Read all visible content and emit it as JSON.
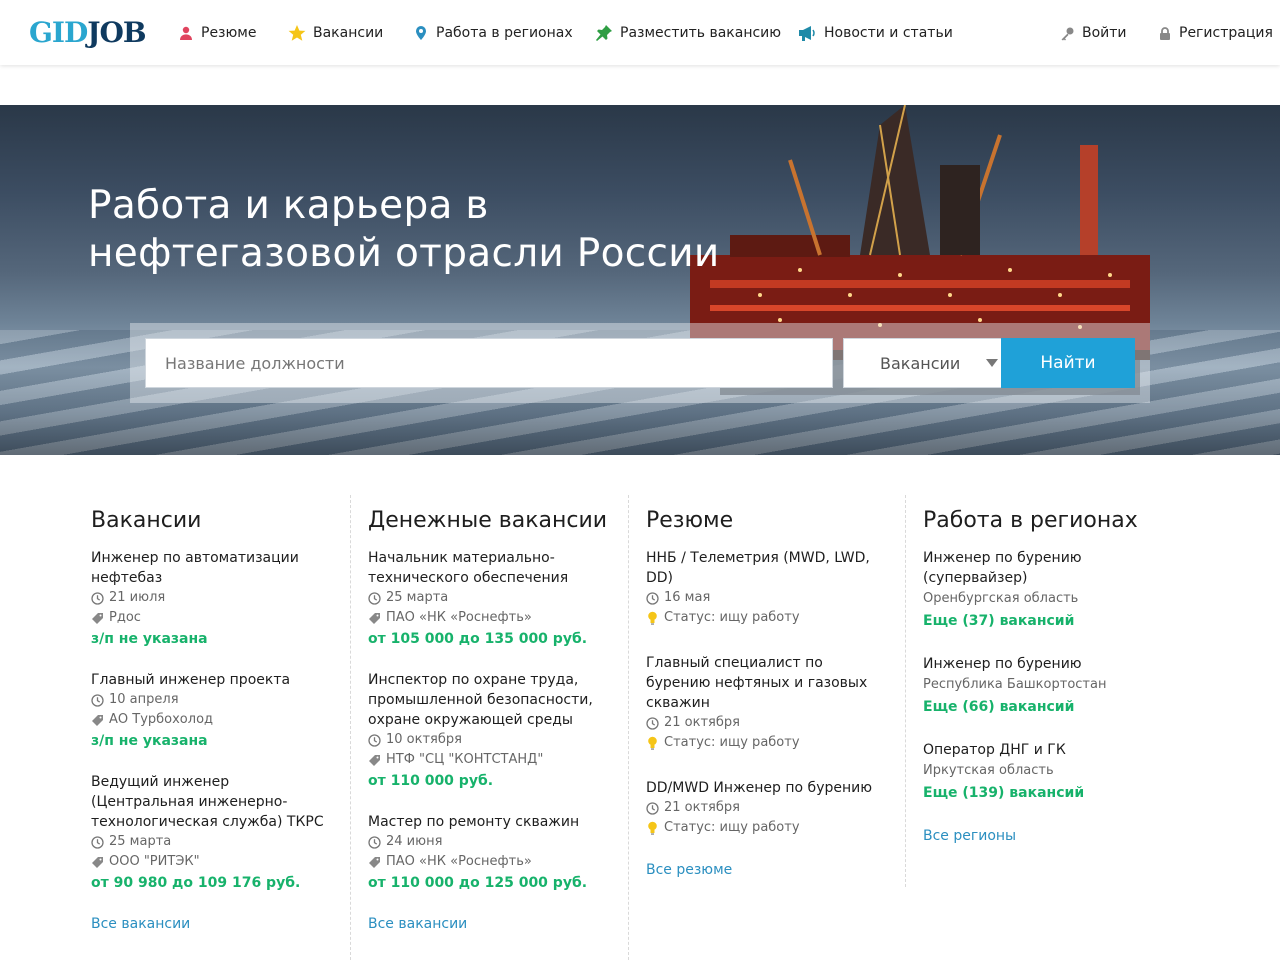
{
  "header": {
    "logo_part1": "GID",
    "logo_part2": "JOB",
    "nav": [
      {
        "label": "Резюме",
        "icon": "user-icon"
      },
      {
        "label": "Вакансии",
        "icon": "star-icon"
      },
      {
        "label": "Работа в регионах",
        "icon": "map-pin-icon"
      },
      {
        "label": "Разместить вакансию",
        "icon": "pushpin-icon"
      },
      {
        "label": "Новости и статьи",
        "icon": "megaphone-icon"
      }
    ],
    "login": "Войти",
    "register": "Регистрация"
  },
  "hero": {
    "title_line1": "Работа и карьера в",
    "title_line2": "нефтегазовой отрасли России",
    "search_placeholder": "Название должности",
    "select_value": "Вакансии",
    "search_button": "Найти"
  },
  "columns": {
    "vacancies": {
      "heading": "Вакансии",
      "items": [
        {
          "title": "Инженер по автоматизации нефтебаз",
          "date": "21 июля",
          "company": "Рдос",
          "salary": "з/п не указана"
        },
        {
          "title": "Главный инженер проекта",
          "date": "10 апреля",
          "company": "АО Турбохолод",
          "salary": "з/п не указана"
        },
        {
          "title": "Ведущий инженер (Центральная инженерно-технологическая служба) ТКРС",
          "date": "25 марта",
          "company": "ООО \"РИТЭК\"",
          "salary": "от 90 980 до 109 176 руб."
        }
      ],
      "all_link": "Все вакансии"
    },
    "money": {
      "heading": "Денежные вакансии",
      "items": [
        {
          "title": "Начальник материально-технического обеспечения",
          "date": "25 марта",
          "company": "ПАО «НК «Роснефть»",
          "salary": "от 105 000 до 135 000 руб."
        },
        {
          "title": "Инспектор по охране труда, промышленной безопасности, охране окружающей среды",
          "date": "10 октября",
          "company": "НТФ \"СЦ \"КОНТСТАНД\"",
          "salary": "от 110 000 руб."
        },
        {
          "title": "Мастер по ремонту скважин",
          "date": "24 июня",
          "company": "ПАО «НК «Роснефть»",
          "salary": "от 110 000 до 125 000 руб."
        }
      ],
      "all_link": "Все вакансии"
    },
    "resume": {
      "heading": "Резюме",
      "items": [
        {
          "title": "ННБ / Телеметрия (MWD, LWD, DD)",
          "date": "16 мая",
          "status": "Статус: ищу работу"
        },
        {
          "title": "Главный специалист по бурению нефтяных и газовых скважин",
          "date": "21 октября",
          "status": "Статус: ищу работу"
        },
        {
          "title": "DD/MWD Инженер по бурению",
          "date": "21 октября",
          "status": "Статус: ищу работу"
        }
      ],
      "all_link": "Все резюме"
    },
    "regions": {
      "heading": "Работа в регионах",
      "items": [
        {
          "title": "Инженер по бурению (супервайзер)",
          "region": "Оренбургская область",
          "more": "Еще (37) вакансий"
        },
        {
          "title": "Инженер по бурению",
          "region": "Республика Башкортостан",
          "more": "Еще (66) вакансий"
        },
        {
          "title": "Оператор ДНГ и ГК",
          "region": "Иркутская область",
          "more": "Еще (139) вакансий"
        }
      ],
      "all_link": "Все регионы"
    }
  },
  "colors": {
    "accent_blue": "#1fa1d8",
    "salary_green": "#17b26b",
    "link_blue": "#2b8fc0",
    "logo_light": "#2aa6cf",
    "logo_dark": "#0f3a5f"
  }
}
